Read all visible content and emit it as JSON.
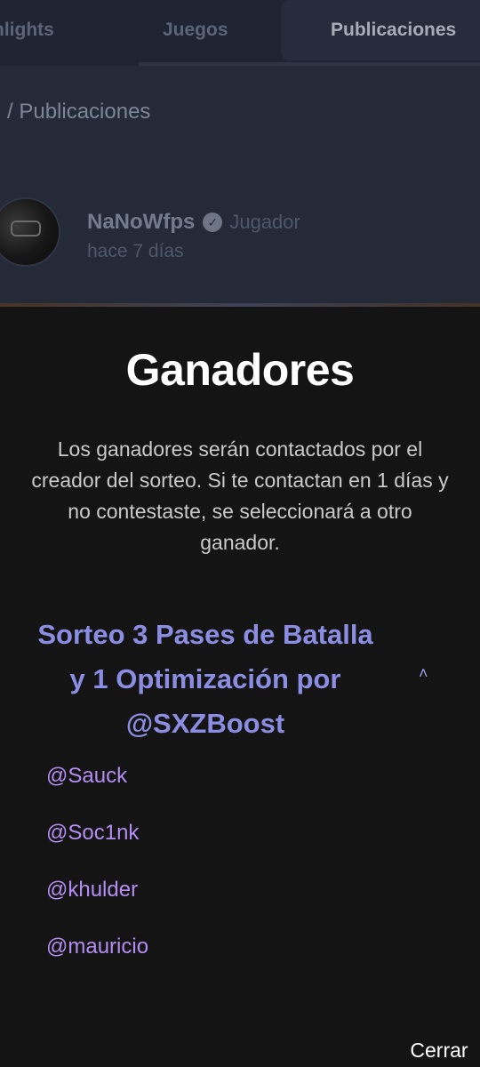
{
  "tabs": [
    {
      "label": "hlights"
    },
    {
      "label": "Juegos"
    },
    {
      "label": "Publicaciones"
    }
  ],
  "section_title": "/ Publicaciones",
  "post": {
    "author": "NaNoWfps",
    "role": "Jugador",
    "time": "hace 7 días",
    "verified_icon": "check-badge"
  },
  "modal": {
    "title": "Ganadores",
    "description": "Los ganadores serán contactados por el creador del sorteo. Si te contactan en 1 días y no contestaste, se seleccionará a otro ganador.",
    "raffle_title": "Sorteo 3 Pases de Batalla y 1 Optimización por @SXZBoost",
    "expand_icon": "chevron-up",
    "winners": [
      "@Sauck",
      "@Soc1nk",
      "@khulder",
      "@mauricio"
    ],
    "close_label": "Cerrar"
  },
  "colors": {
    "modal_bg": "#141414",
    "raffle_title": "#8b8de3",
    "winner": "#b48cf2",
    "dimmed_page": "#242a38"
  }
}
